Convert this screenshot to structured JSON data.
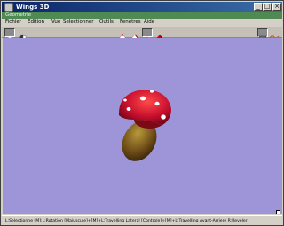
{
  "window": {
    "title": "Wings 3D",
    "minimize_symbol": "_",
    "maximize_symbol": "□",
    "close_symbol": "×"
  },
  "geometry_bar": {
    "label": "Geometrie"
  },
  "menu": {
    "items": [
      "Fichier",
      "Edition",
      "Vue",
      "Selectionner",
      "Outils",
      "Fenetres",
      "Aide"
    ]
  },
  "toolbar": {
    "buttons": [
      "view-mode-icon",
      "undo-arrow-icon",
      "vertex-select-icon",
      "edge-select-icon",
      "face-select-icon",
      "body-select-icon",
      "wireframe-icon",
      "shaded-icon"
    ]
  },
  "viewport": {
    "background_color": "#9d95d8",
    "object": "mushroom"
  },
  "statusbar": {
    "text": "L:Selectionne  [M]:L:Rotation  [Majuscule]+[M]+L:Travelling Lateral  [Controle]+[M]+L:Travelling Avant-Arriere  R:Reveler"
  },
  "colors": {
    "titlebar_start": "#0a246a",
    "titlebar_end": "#3a6ea5",
    "geometry_bar": "#4f8a52",
    "mushroom_cap": "#c8102e",
    "mushroom_stem": "#6b4a16"
  }
}
